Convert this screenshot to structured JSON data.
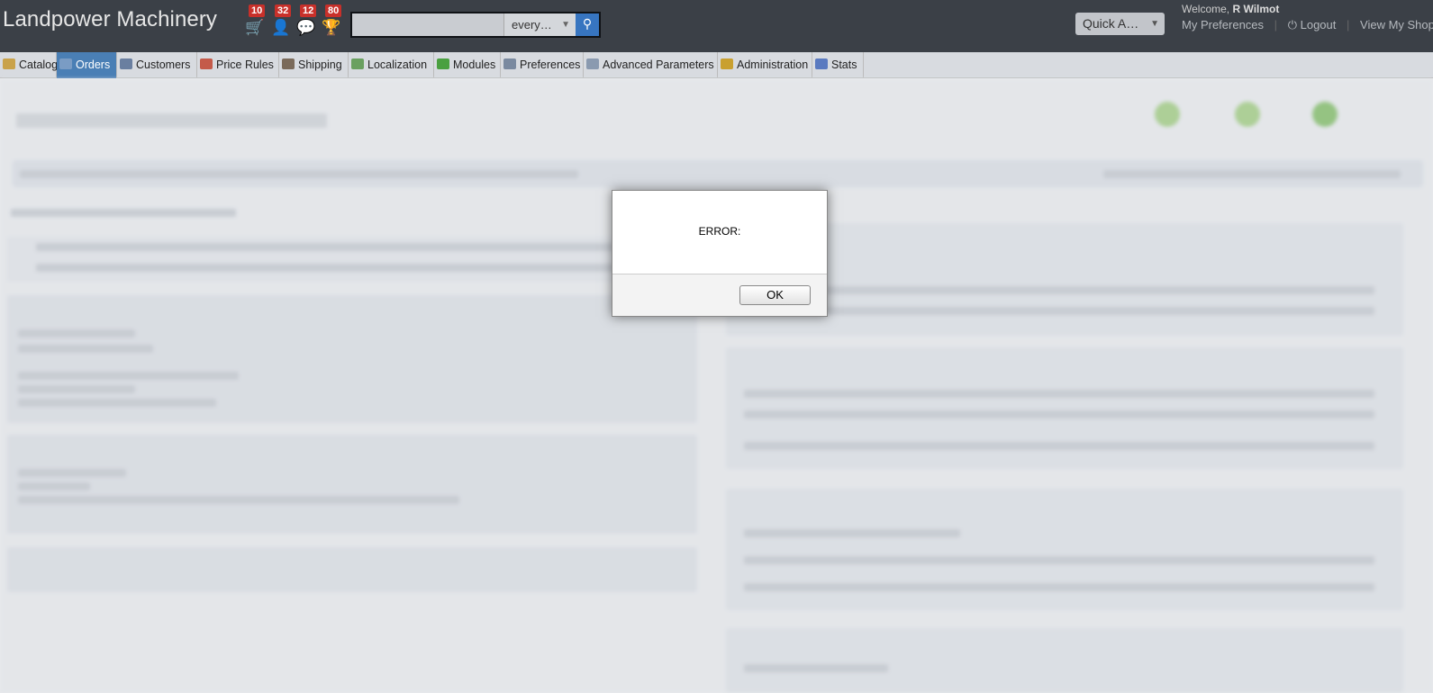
{
  "header": {
    "brand": "Landpower Machinery",
    "notifications": [
      {
        "icon": "cart-icon",
        "count": "10"
      },
      {
        "icon": "customer-icon",
        "count": "32"
      },
      {
        "icon": "message-icon",
        "count": "12"
      },
      {
        "icon": "trophy-icon",
        "count": "80"
      }
    ],
    "search": {
      "value": "",
      "scope": "every…"
    },
    "quick_access": "Quick A…",
    "welcome_prefix": "Welcome,",
    "welcome_name": "R Wilmot",
    "links": {
      "preferences": "My Preferences",
      "logout": "Logout",
      "view_shop": "View My Shop"
    }
  },
  "tabs": [
    {
      "label": "Catalog",
      "icon": "folder-icon",
      "color": "#c9a24a"
    },
    {
      "label": "Orders",
      "icon": "cart-icon",
      "color": "#7a9cc4",
      "active": true
    },
    {
      "label": "Customers",
      "icon": "customer-icon",
      "color": "#6a7fa0"
    },
    {
      "label": "Price Rules",
      "icon": "price-rule-icon",
      "color": "#c45a4a"
    },
    {
      "label": "Shipping",
      "icon": "truck-icon",
      "color": "#7a6a5a"
    },
    {
      "label": "Localization",
      "icon": "globe-icon",
      "color": "#6aa060"
    },
    {
      "label": "Modules",
      "icon": "puzzle-icon",
      "color": "#4aa040"
    },
    {
      "label": "Preferences",
      "icon": "preferences-icon",
      "color": "#7a8aa0"
    },
    {
      "label": "Advanced Parameters",
      "icon": "wrench-icon",
      "color": "#8a9ab0"
    },
    {
      "label": "Administration",
      "icon": "key-icon",
      "color": "#c9a030"
    },
    {
      "label": "Stats",
      "icon": "stats-icon",
      "color": "#5a7ac0"
    }
  ],
  "dialog": {
    "message": "ERROR:",
    "ok_label": "OK"
  }
}
